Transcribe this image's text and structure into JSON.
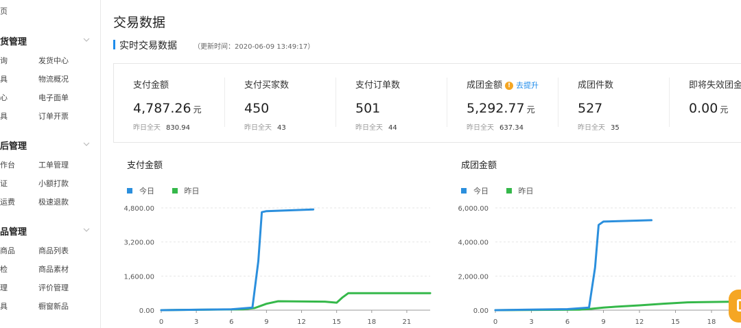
{
  "sidebar": {
    "top_item": "页",
    "groups": [
      {
        "title": "货管理",
        "items": [
          [
            "询",
            "发货中心"
          ],
          [
            "具",
            "物流概况"
          ],
          [
            "心",
            "电子面单"
          ],
          [
            "具",
            "订单开票"
          ]
        ]
      },
      {
        "title": "后管理",
        "items": [
          [
            "作台",
            "工单管理"
          ],
          [
            "证",
            "小额打款"
          ],
          [
            "运费",
            "极速退款"
          ]
        ]
      },
      {
        "title": "品管理",
        "items": [
          [
            "商品",
            "商品列表"
          ],
          [
            "检",
            "商品素材"
          ],
          [
            "理",
            "评价管理"
          ],
          [
            "具",
            "橱窗新品"
          ]
        ]
      }
    ]
  },
  "page": {
    "title": "交易数据",
    "section_title": "实时交易数据",
    "updated": "（更新时间：2020-06-09 13:49:17）"
  },
  "metrics": [
    {
      "label": "支付金额",
      "value": "4,787.26",
      "unit": "元",
      "sub_label": "昨日全天",
      "sub_value": "830.94"
    },
    {
      "label": "支付买家数",
      "value": "450",
      "unit": "",
      "sub_label": "昨日全天",
      "sub_value": "43"
    },
    {
      "label": "支付订单数",
      "value": "501",
      "unit": "",
      "sub_label": "昨日全天",
      "sub_value": "44"
    },
    {
      "label": "成团金额",
      "value": "5,292.77",
      "unit": "元",
      "sub_label": "昨日全天",
      "sub_value": "637.34",
      "warn": "!",
      "link": "去提升"
    },
    {
      "label": "成团件数",
      "value": "527",
      "unit": "",
      "sub_label": "昨日全天",
      "sub_value": "35"
    },
    {
      "label": "即将失效团金",
      "value": "0.00",
      "unit": "元",
      "sub_label": "",
      "sub_value": ""
    }
  ],
  "colors": {
    "today": "#2b8fdd",
    "yesterday": "#35b84a",
    "accent": "#1f8ceb",
    "fab": "#f5a623"
  },
  "icons": {
    "chevron": "chevron-down-icon",
    "warning": "warning-icon",
    "fab": "document-icon"
  },
  "chart_data": [
    {
      "type": "line",
      "title": "支付金额",
      "legend_position": "top-left",
      "grid": true,
      "x_ticks": [
        0,
        3,
        6,
        9,
        12,
        15,
        18,
        21
      ],
      "y_ticks": [
        "0.00",
        "1,600.00",
        "3,200.00",
        "4,800.00"
      ],
      "xlim": [
        0,
        23
      ],
      "ylim": [
        0,
        4800
      ],
      "series": [
        {
          "name": "今日",
          "x": [
            0,
            6,
            7.8,
            8.3,
            8.6,
            9,
            13
          ],
          "y": [
            0,
            40,
            120,
            2300,
            4600,
            4650,
            4730
          ]
        },
        {
          "name": "昨日",
          "x": [
            0,
            7,
            8,
            9,
            10,
            14,
            15,
            15.5,
            16,
            16.5,
            23
          ],
          "y": [
            0,
            40,
            100,
            300,
            420,
            400,
            350,
            600,
            800,
            800,
            800
          ]
        }
      ]
    },
    {
      "type": "line",
      "title": "成团金额",
      "legend_position": "top-left",
      "grid": true,
      "x_ticks": [
        0,
        3,
        6,
        9,
        12,
        15,
        18
      ],
      "y_ticks": [
        "0.00",
        "2,000.00",
        "4,000.00",
        "6,000.00"
      ],
      "xlim": [
        0,
        20
      ],
      "ylim": [
        0,
        6000
      ],
      "series": [
        {
          "name": "今日",
          "x": [
            0,
            6,
            7.8,
            8.3,
            8.6,
            9,
            13
          ],
          "y": [
            0,
            60,
            150,
            2500,
            5000,
            5200,
            5280
          ]
        },
        {
          "name": "昨日",
          "x": [
            0,
            7,
            8,
            9,
            10,
            12,
            14,
            16,
            20
          ],
          "y": [
            0,
            30,
            80,
            150,
            200,
            280,
            380,
            460,
            500
          ]
        }
      ]
    }
  ]
}
